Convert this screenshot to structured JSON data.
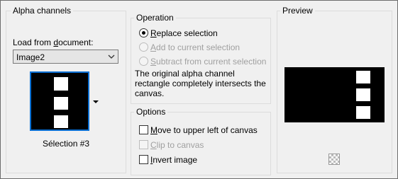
{
  "alpha_channels": {
    "title": "Alpha channels",
    "load_label_pre": "Load from ",
    "load_label_u": "d",
    "load_label_post": "ocument:",
    "document_select": "Image2",
    "selection_name": "Sélection #3"
  },
  "operation": {
    "title": "Operation",
    "options": [
      {
        "pre": "",
        "u": "R",
        "post": "eplace selection",
        "selected": true,
        "enabled": true
      },
      {
        "pre": "",
        "u": "A",
        "post": "dd to current selection",
        "selected": false,
        "enabled": false
      },
      {
        "pre": "",
        "u": "S",
        "post": "ubtract from current selection",
        "selected": false,
        "enabled": false
      }
    ],
    "info": "The original alpha channel rectangle completely intersects the canvas."
  },
  "options": {
    "title": "Options",
    "checkboxes": [
      {
        "pre": "",
        "u": "M",
        "post": "ove to upper left of canvas",
        "checked": false,
        "enabled": true
      },
      {
        "pre": "",
        "u": "C",
        "post": "lip to canvas",
        "checked": false,
        "enabled": false
      },
      {
        "pre": "",
        "u": "I",
        "post": "nvert image",
        "checked": false,
        "enabled": true
      }
    ]
  },
  "preview": {
    "title": "Preview"
  },
  "icons": {
    "dropdown": "chevron-down-icon",
    "thumb_menu": "triangle-down-icon",
    "transparency": "checkerboard-icon"
  }
}
